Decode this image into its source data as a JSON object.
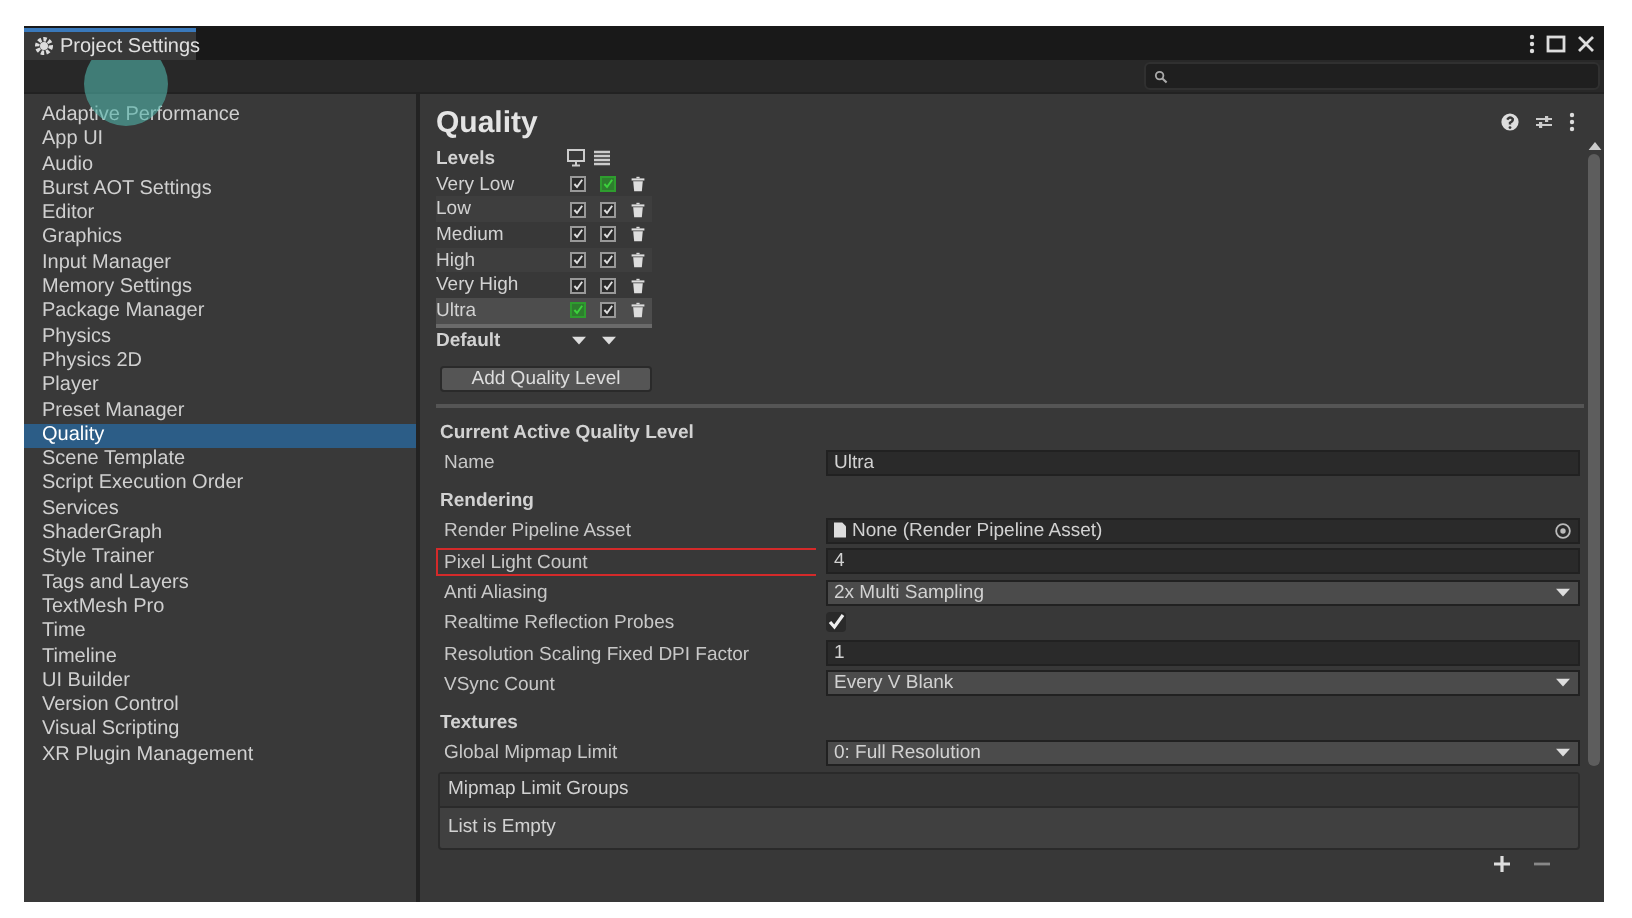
{
  "window": {
    "title": "Project Settings"
  },
  "sidebar": {
    "items": [
      {
        "label": "Adaptive Performance",
        "selected": false
      },
      {
        "label": "App UI",
        "selected": false
      },
      {
        "label": "Audio",
        "selected": false
      },
      {
        "label": "Burst AOT Settings",
        "selected": false
      },
      {
        "label": "Editor",
        "selected": false
      },
      {
        "label": "Graphics",
        "selected": false
      },
      {
        "label": "Input Manager",
        "selected": false
      },
      {
        "label": "Memory Settings",
        "selected": false
      },
      {
        "label": "Package Manager",
        "selected": false
      },
      {
        "label": "Physics",
        "selected": false
      },
      {
        "label": "Physics 2D",
        "selected": false
      },
      {
        "label": "Player",
        "selected": false
      },
      {
        "label": "Preset Manager",
        "selected": false
      },
      {
        "label": "Quality",
        "selected": true
      },
      {
        "label": "Scene Template",
        "selected": false
      },
      {
        "label": "Script Execution Order",
        "selected": false
      },
      {
        "label": "Services",
        "selected": false
      },
      {
        "label": "ShaderGraph",
        "selected": false
      },
      {
        "label": "Style Trainer",
        "selected": false
      },
      {
        "label": "Tags and Layers",
        "selected": false
      },
      {
        "label": "TextMesh Pro",
        "selected": false
      },
      {
        "label": "Time",
        "selected": false
      },
      {
        "label": "Timeline",
        "selected": false
      },
      {
        "label": "UI Builder",
        "selected": false
      },
      {
        "label": "Version Control",
        "selected": false
      },
      {
        "label": "Visual Scripting",
        "selected": false
      },
      {
        "label": "XR Plugin Management",
        "selected": false
      }
    ]
  },
  "panel": {
    "title": "Quality",
    "levels": {
      "heading": "Levels",
      "rows": [
        {
          "name": "Very Low",
          "selected": false,
          "standalone": true,
          "standalone_default": false,
          "mobile": true,
          "mobile_default": true
        },
        {
          "name": "Low",
          "selected": false,
          "standalone": true,
          "standalone_default": false,
          "mobile": true,
          "mobile_default": false
        },
        {
          "name": "Medium",
          "selected": false,
          "standalone": true,
          "standalone_default": false,
          "mobile": true,
          "mobile_default": false
        },
        {
          "name": "High",
          "selected": false,
          "standalone": true,
          "standalone_default": false,
          "mobile": true,
          "mobile_default": false
        },
        {
          "name": "Very High",
          "selected": false,
          "standalone": true,
          "standalone_default": false,
          "mobile": true,
          "mobile_default": false
        },
        {
          "name": "Ultra",
          "selected": true,
          "standalone": true,
          "standalone_default": true,
          "mobile": true,
          "mobile_default": false
        }
      ],
      "default_label": "Default",
      "add_button": "Add Quality Level"
    },
    "sections": [
      {
        "heading": "Current Active Quality Level",
        "rows": [
          {
            "kind": "text",
            "label": "Name",
            "value": "Ultra",
            "highlighted": false
          }
        ]
      },
      {
        "heading": "Rendering",
        "rows": [
          {
            "kind": "object",
            "label": "Render Pipeline Asset",
            "value": "None (Render Pipeline Asset)",
            "highlighted": false
          },
          {
            "kind": "text",
            "label": "Pixel Light Count",
            "value": "4",
            "highlighted": true
          },
          {
            "kind": "dropdown",
            "label": "Anti Aliasing",
            "value": "2x Multi Sampling",
            "highlighted": false
          },
          {
            "kind": "checkbox",
            "label": "Realtime Reflection Probes",
            "checked": true,
            "highlighted": false
          },
          {
            "kind": "text",
            "label": "Resolution Scaling Fixed DPI Factor",
            "value": "1",
            "highlighted": false
          },
          {
            "kind": "dropdown",
            "label": "VSync Count",
            "value": "Every V Blank",
            "highlighted": false
          }
        ]
      },
      {
        "heading": "Textures",
        "rows": [
          {
            "kind": "dropdown",
            "label": "Global Mipmap Limit",
            "value": "0: Full Resolution",
            "highlighted": false
          }
        ]
      }
    ],
    "list": {
      "title": "Mipmap Limit Groups",
      "empty_text": "List is Empty"
    }
  }
}
